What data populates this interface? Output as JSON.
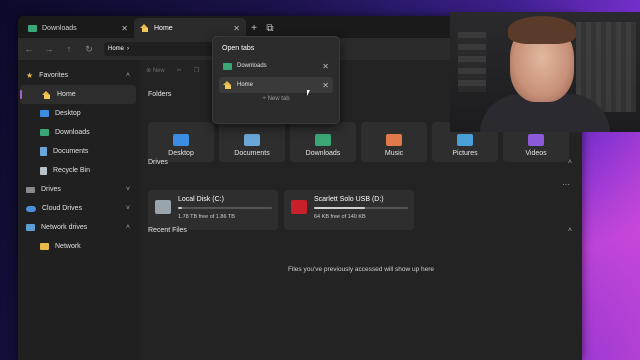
{
  "tabs": [
    {
      "label": "Downloads",
      "icon": "folder-green-icon",
      "active": false
    },
    {
      "label": "Home",
      "icon": "home-icon",
      "active": true
    }
  ],
  "tab_actions": {
    "add": "+",
    "list": "⧉"
  },
  "address": {
    "path": "Home",
    "separator": "›"
  },
  "toolbar": {
    "new_label": "New"
  },
  "sidebar": {
    "items": [
      {
        "label": "Favorites",
        "icon": "star-icon",
        "level": 0,
        "expandable": true
      },
      {
        "label": "Home",
        "icon": "home-icon",
        "level": 1,
        "selected": true
      },
      {
        "label": "Desktop",
        "icon": "desktop-icon",
        "level": 1
      },
      {
        "label": "Downloads",
        "icon": "downloads-icon",
        "level": 1
      },
      {
        "label": "Documents",
        "icon": "documents-icon",
        "level": 1
      },
      {
        "label": "Recycle Bin",
        "icon": "recycle-bin-icon",
        "level": 1
      },
      {
        "label": "Drives",
        "icon": "drive-icon",
        "level": 0,
        "expandable": true
      },
      {
        "label": "Cloud Drives",
        "icon": "cloud-icon",
        "level": 0,
        "expandable": true
      },
      {
        "label": "Network drives",
        "icon": "network-icon",
        "level": 0,
        "expandable": true
      },
      {
        "label": "Network",
        "icon": "network-folder-icon",
        "level": 1
      }
    ]
  },
  "main": {
    "folders_title": "Folders",
    "folders": [
      {
        "label": "Desktop",
        "color": "#3a8de0"
      },
      {
        "label": "Documents",
        "color": "#6aa6d8"
      },
      {
        "label": "Downloads",
        "color": "#3aa876"
      },
      {
        "label": "Music",
        "color": "#e07a4a"
      },
      {
        "label": "Pictures",
        "color": "#4a9fd8"
      },
      {
        "label": "Videos",
        "color": "#8a5ad8"
      }
    ],
    "drives_title": "Drives",
    "drives": [
      {
        "name": "Local Disk (C:)",
        "free": "1.78 TB free of 1.86 TB",
        "used_fraction": 0.04,
        "icon_color": "#9aa4ad"
      },
      {
        "name": "Scarlett Solo USB (D:)",
        "free": "64 KB free of 140 KB",
        "used_fraction": 0.54,
        "icon_color": "#c8202a"
      }
    ],
    "recent_title": "Recent Files",
    "recent_empty": "Files you've previously accessed will show up here"
  },
  "flyout": {
    "title": "Open tabs",
    "items": [
      {
        "label": "Downloads",
        "selected": false
      },
      {
        "label": "Home",
        "selected": true
      }
    ],
    "new_tab": "+ New tab"
  },
  "colors": {
    "accent": "#a55ed8",
    "window_bg": "#202020",
    "card_bg": "#2e2e2e"
  }
}
